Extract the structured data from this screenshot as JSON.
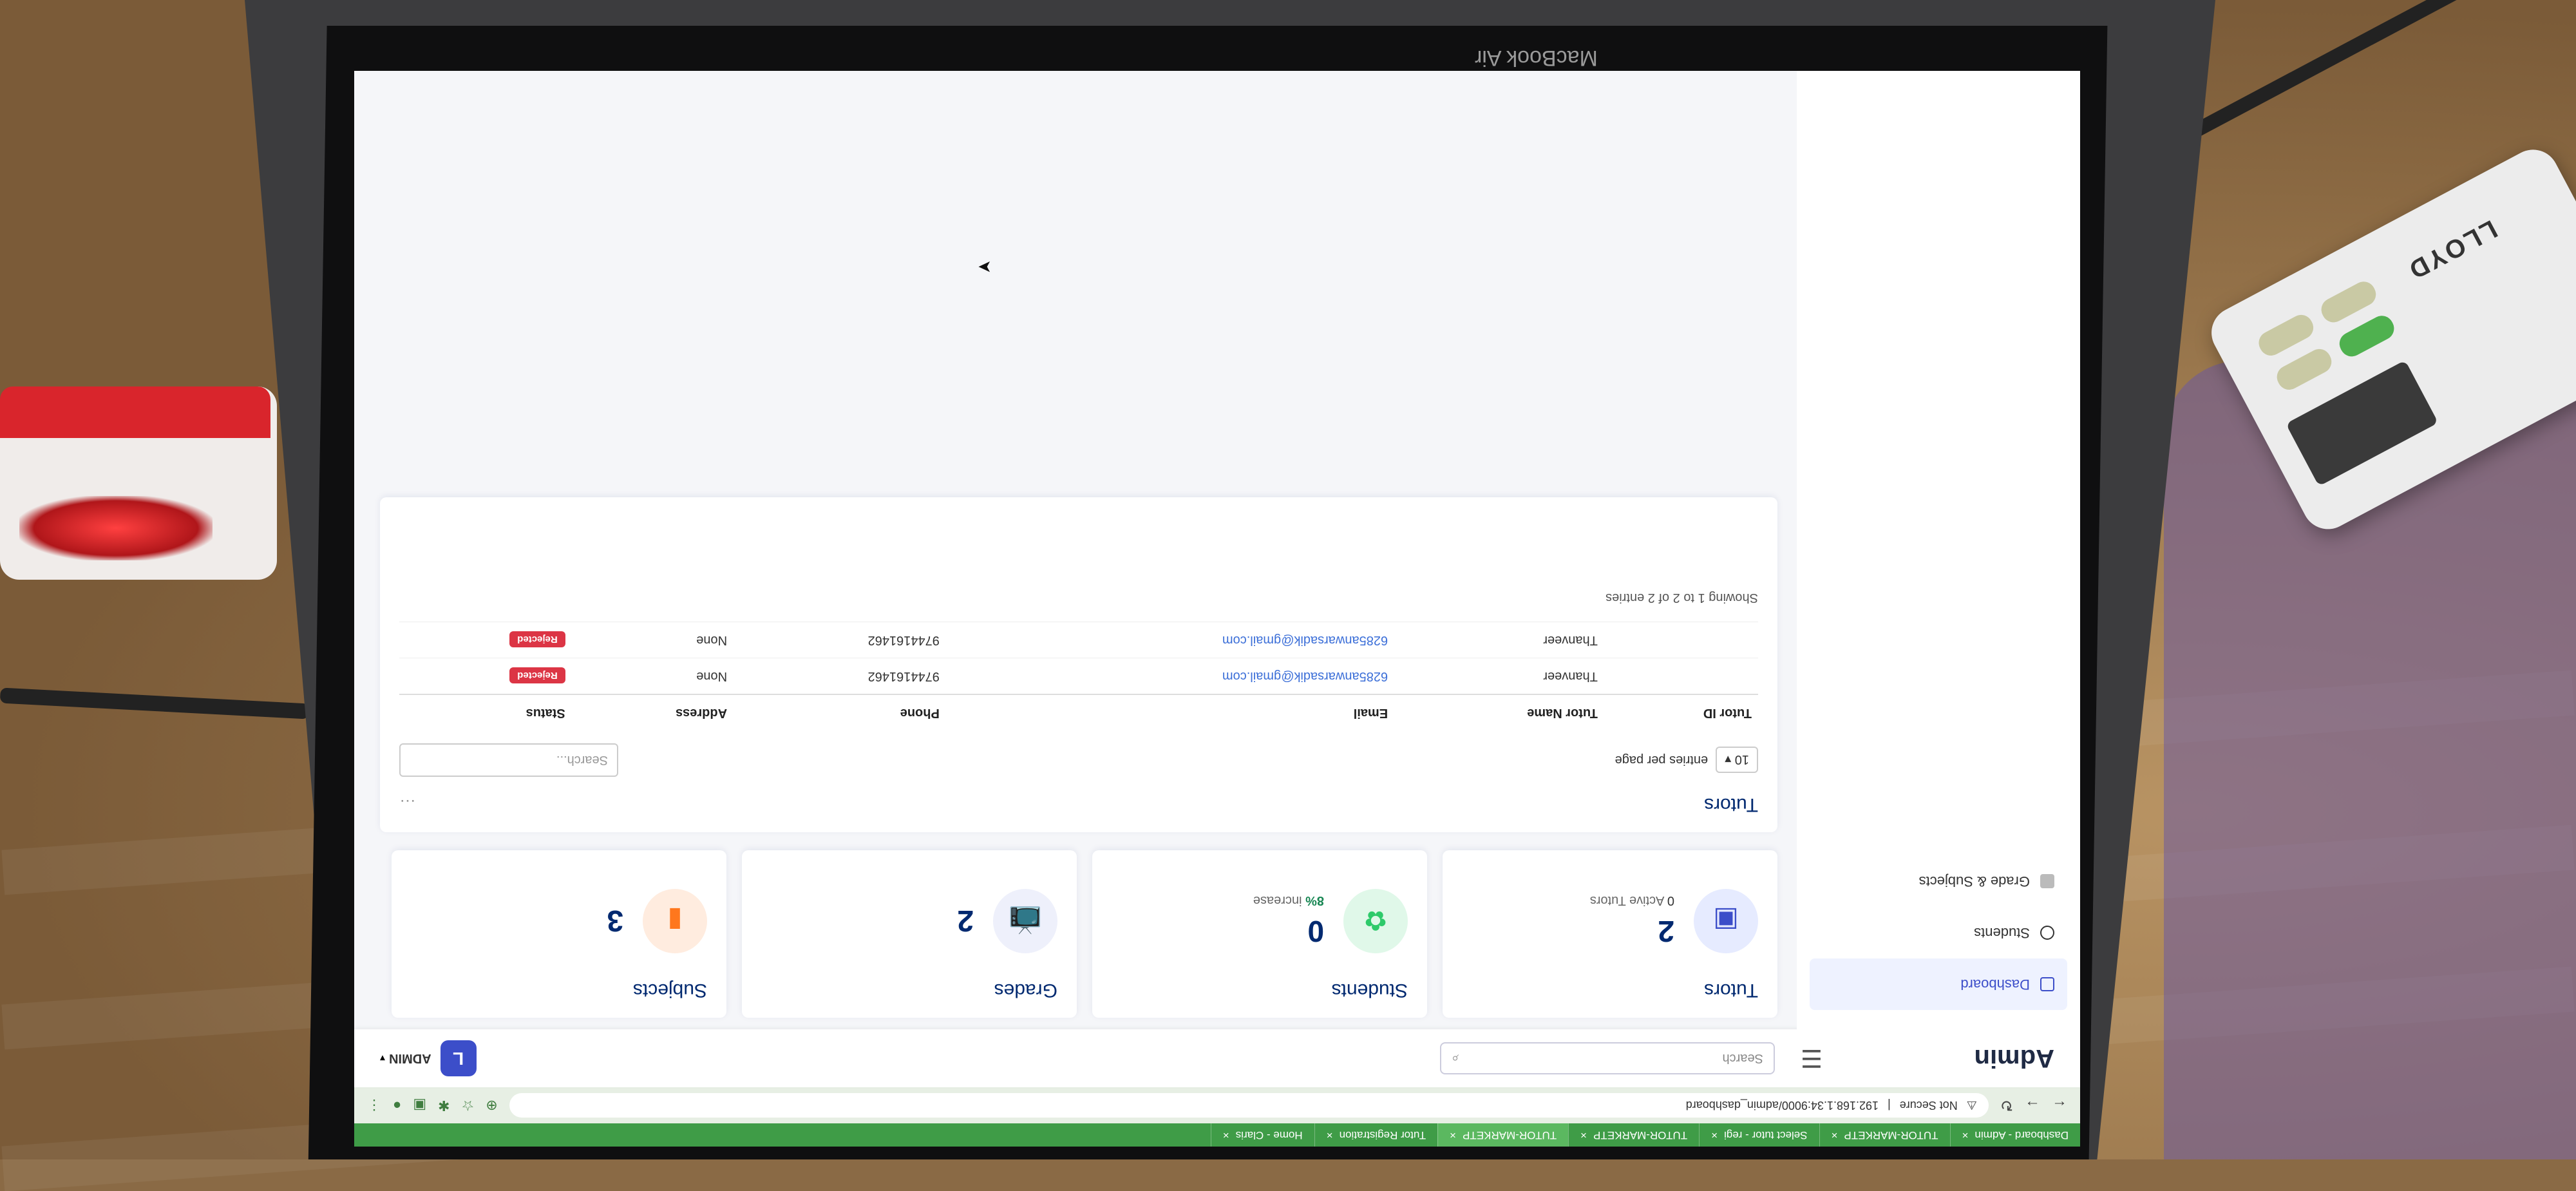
{
  "scene": {
    "laptop_label": "MacBook Air",
    "remote_brand": "LLOYD"
  },
  "browser": {
    "tabs": [
      {
        "label": "Dashboard - Admin",
        "active": false
      },
      {
        "label": "TUTOR-MARKETP",
        "active": false
      },
      {
        "label": "Select tutor - regi",
        "active": false
      },
      {
        "label": "TUTOR-MARKETP",
        "active": false
      },
      {
        "label": "TUTOR-MARKETP",
        "active": true
      },
      {
        "label": "Tutor Registration",
        "active": false
      },
      {
        "label": "Home - Claris",
        "active": false
      }
    ],
    "security": "Not Secure",
    "url": "192.168.1.34:9000/admin_dashboard"
  },
  "header": {
    "brand": "Admin",
    "search_placeholder": "Search",
    "user": "ADMIN",
    "avatar_initial": "L"
  },
  "sidebar": {
    "items": [
      {
        "label": "Dashboard",
        "active": true
      },
      {
        "label": "Students",
        "active": false
      },
      {
        "label": "Grade & Subjects",
        "active": false
      }
    ]
  },
  "cards": [
    {
      "title": "Tutors",
      "value": "2",
      "sub_value": "0",
      "sub_text": "Active Tutors",
      "icon": "tutor-id-icon",
      "color": "#3c4ec9",
      "bg": "#e6ebff"
    },
    {
      "title": "Students",
      "value": "0",
      "sub_value": "8%",
      "sub_text": "increase",
      "icon": "students-icon",
      "color": "#2eca6a",
      "bg": "#e0f8e9"
    },
    {
      "title": "Grades",
      "value": "2",
      "sub_value": "",
      "sub_text": "",
      "icon": "monitor-icon",
      "color": "#7b8cc4",
      "bg": "#eef0fb"
    },
    {
      "title": "Subjects",
      "value": "3",
      "sub_value": "",
      "sub_text": "",
      "icon": "book-icon",
      "color": "#ff771d",
      "bg": "#ffecdf"
    }
  ],
  "tutors_table": {
    "title": "Tutors",
    "per_page_value": "10",
    "per_page_label": "entries per page",
    "search_placeholder": "Search...",
    "columns": [
      "Tutor ID",
      "Tutor Name",
      "Email",
      "Phone",
      "Address",
      "Status"
    ],
    "rows": [
      {
        "id": "",
        "name": "Thanveer",
        "email": "6285anwarsadik@gmail.com",
        "phone": "9744161462",
        "address": "None",
        "status": "Rejected"
      },
      {
        "id": "",
        "name": "Thanveer",
        "email": "6285anwarsadik@gmail.com",
        "phone": "9744161462",
        "address": "None",
        "status": "Rejected"
      }
    ],
    "footer": "Showing 1 to 2 of 2 entries"
  }
}
